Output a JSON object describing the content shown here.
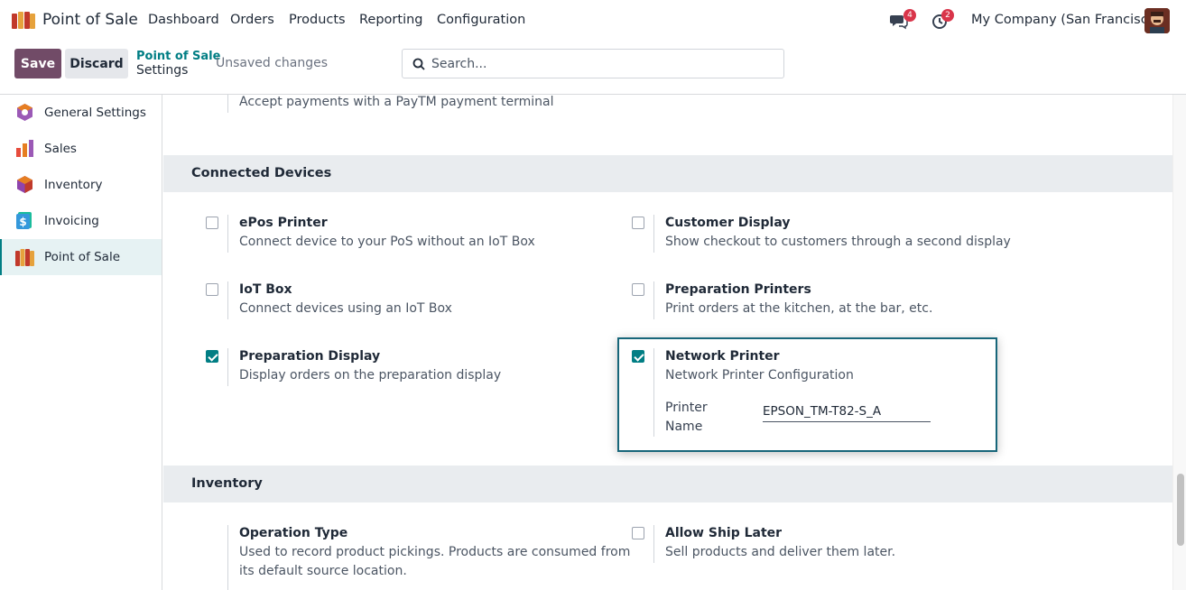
{
  "navbar": {
    "app_title": "Point of Sale",
    "menu": [
      "Dashboard",
      "Orders",
      "Products",
      "Reporting",
      "Configuration"
    ],
    "messages_count": "4",
    "activities_count": "2",
    "company": "My Company (San Francisco)"
  },
  "control_panel": {
    "save_label": "Save",
    "discard_label": "Discard",
    "breadcrumb_parent": "Point of Sale",
    "breadcrumb_current": "Settings",
    "status": "Unsaved changes",
    "search_placeholder": "Search..."
  },
  "sidebar": {
    "items": [
      {
        "label": "General Settings",
        "icon": "general-settings-icon"
      },
      {
        "label": "Sales",
        "icon": "sales-icon"
      },
      {
        "label": "Inventory",
        "icon": "inventory-icon"
      },
      {
        "label": "Invoicing",
        "icon": "invoicing-icon"
      },
      {
        "label": "Point of Sale",
        "icon": "point-of-sale-icon",
        "active": true
      }
    ]
  },
  "content": {
    "paytm_desc": "Accept payments with a PayTM payment terminal",
    "connected_devices": {
      "heading": "Connected Devices",
      "epos": {
        "title": "ePos Printer",
        "desc": "Connect device to your PoS without an IoT Box",
        "checked": false
      },
      "customer_display": {
        "title": "Customer Display",
        "desc": "Show checkout to customers through a second display",
        "checked": false
      },
      "iot_box": {
        "title": "IoT Box",
        "desc": "Connect devices using an IoT Box",
        "checked": false
      },
      "prep_printers": {
        "title": "Preparation Printers",
        "desc": "Print orders at the kitchen, at the bar, etc.",
        "checked": false
      },
      "prep_display": {
        "title": "Preparation Display",
        "desc": "Display orders on the preparation display",
        "checked": true
      },
      "network_printer": {
        "title": "Network Printer",
        "desc": "Network Printer Configuration",
        "checked": true,
        "printer_label_line1": "Printer",
        "printer_label_line2": "Name",
        "printer_name": "EPSON_TM-T82-S_A"
      }
    },
    "inventory": {
      "heading": "Inventory",
      "operation_type": {
        "title": "Operation Type",
        "desc_line1": "Used to record product pickings. Products are consumed from",
        "desc_line2": "its default source location."
      },
      "ship_later": {
        "title": "Allow Ship Later",
        "desc": "Sell products and deliver them later.",
        "checked": false
      }
    }
  },
  "colors": {
    "brand": "#714b67",
    "accent": "#017e84",
    "badge": "#d9354a",
    "highlight_border": "#17667a"
  }
}
